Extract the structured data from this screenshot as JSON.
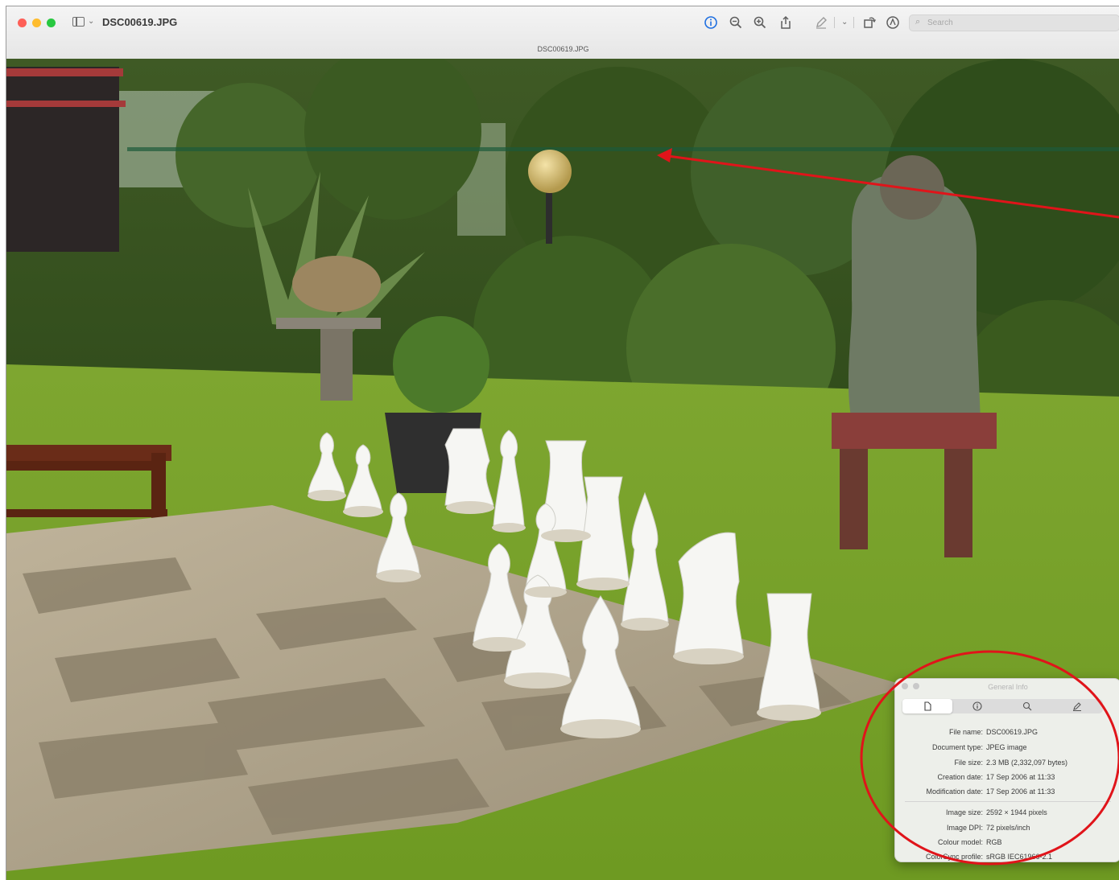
{
  "window": {
    "title": "DSC00619.JPG",
    "document_subtitle": "DSC00619.JPG"
  },
  "toolbar": {
    "icons": [
      "info-icon",
      "zoom-out-icon",
      "zoom-in-icon",
      "share-icon",
      "markup-icon",
      "chevron-down-icon",
      "rotate-icon",
      "annotate-icon"
    ],
    "search_placeholder": "Search"
  },
  "info_panel": {
    "title": "General Info",
    "tabs": [
      "file-tab",
      "info-tab",
      "search-tab",
      "edit-tab"
    ],
    "selected_tab": 0,
    "rows": [
      {
        "label": "File name:",
        "value": "DSC00619.JPG"
      },
      {
        "label": "Document type:",
        "value": "JPEG image"
      },
      {
        "label": "File size:",
        "value": "2.3 MB (2,332,097 bytes)"
      },
      {
        "label": "Creation date:",
        "value": "17 Sep 2006 at 11:33"
      },
      {
        "label": "Modification date:",
        "value": "17 Sep 2006 at 11:33"
      },
      {
        "label": "Image size:",
        "value": "2592 × 1944 pixels"
      },
      {
        "label": "Image DPI:",
        "value": "72 pixels/inch"
      },
      {
        "label": "Colour model:",
        "value": "RGB"
      },
      {
        "label": "ColorSync profile:",
        "value": "sRGB IEC61966-2.1"
      }
    ]
  },
  "annotations": {
    "arrow_color": "#e0141a",
    "circle_color": "#e0141a"
  }
}
